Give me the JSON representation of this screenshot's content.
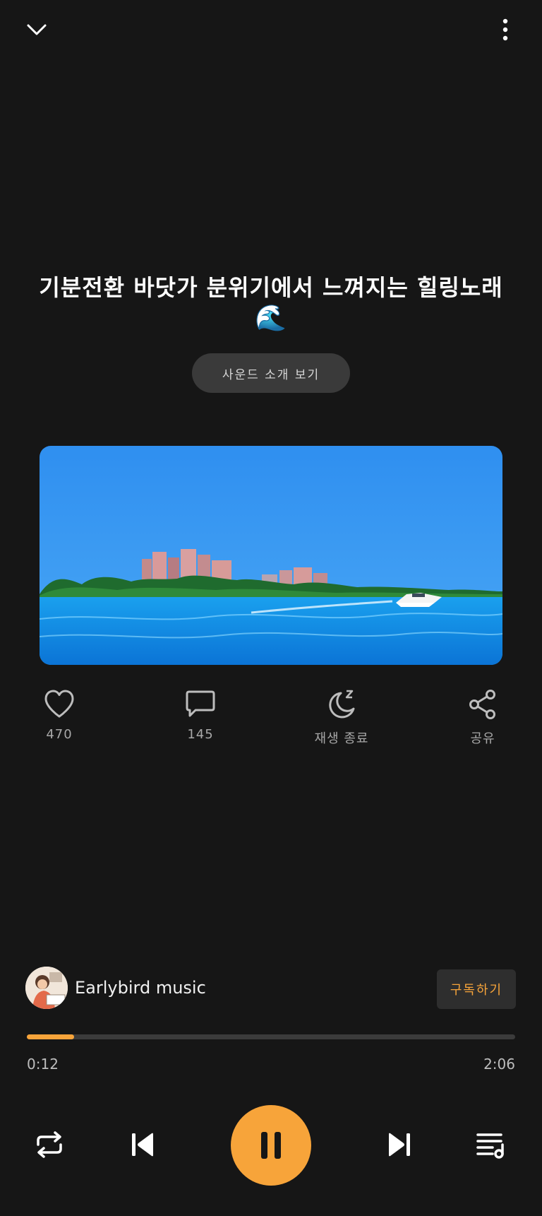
{
  "header": {
    "collapse_icon": "chevron-down-icon",
    "menu_icon": "more-vertical-icon"
  },
  "track": {
    "title": "기분전환 바닷가 분위기에서 느껴지는 힐링노래",
    "title_emoji": "🌊",
    "intro_button": "사운드 소개 보기"
  },
  "actions": {
    "like": {
      "icon": "heart-icon",
      "label": "470"
    },
    "comment": {
      "icon": "comment-icon",
      "label": "145"
    },
    "sleep": {
      "icon": "moon-sleep-icon",
      "label": "재생 종료"
    },
    "share": {
      "icon": "share-icon",
      "label": "공유"
    }
  },
  "channel": {
    "name": "Earlybird music",
    "subscribe_label": "구독하기"
  },
  "player": {
    "current_time": "0:12",
    "duration": "2:06",
    "progress": 0.097
  },
  "colors": {
    "accent": "#f7a43a",
    "background": "#161616",
    "button_bg": "#3a3a3a"
  }
}
